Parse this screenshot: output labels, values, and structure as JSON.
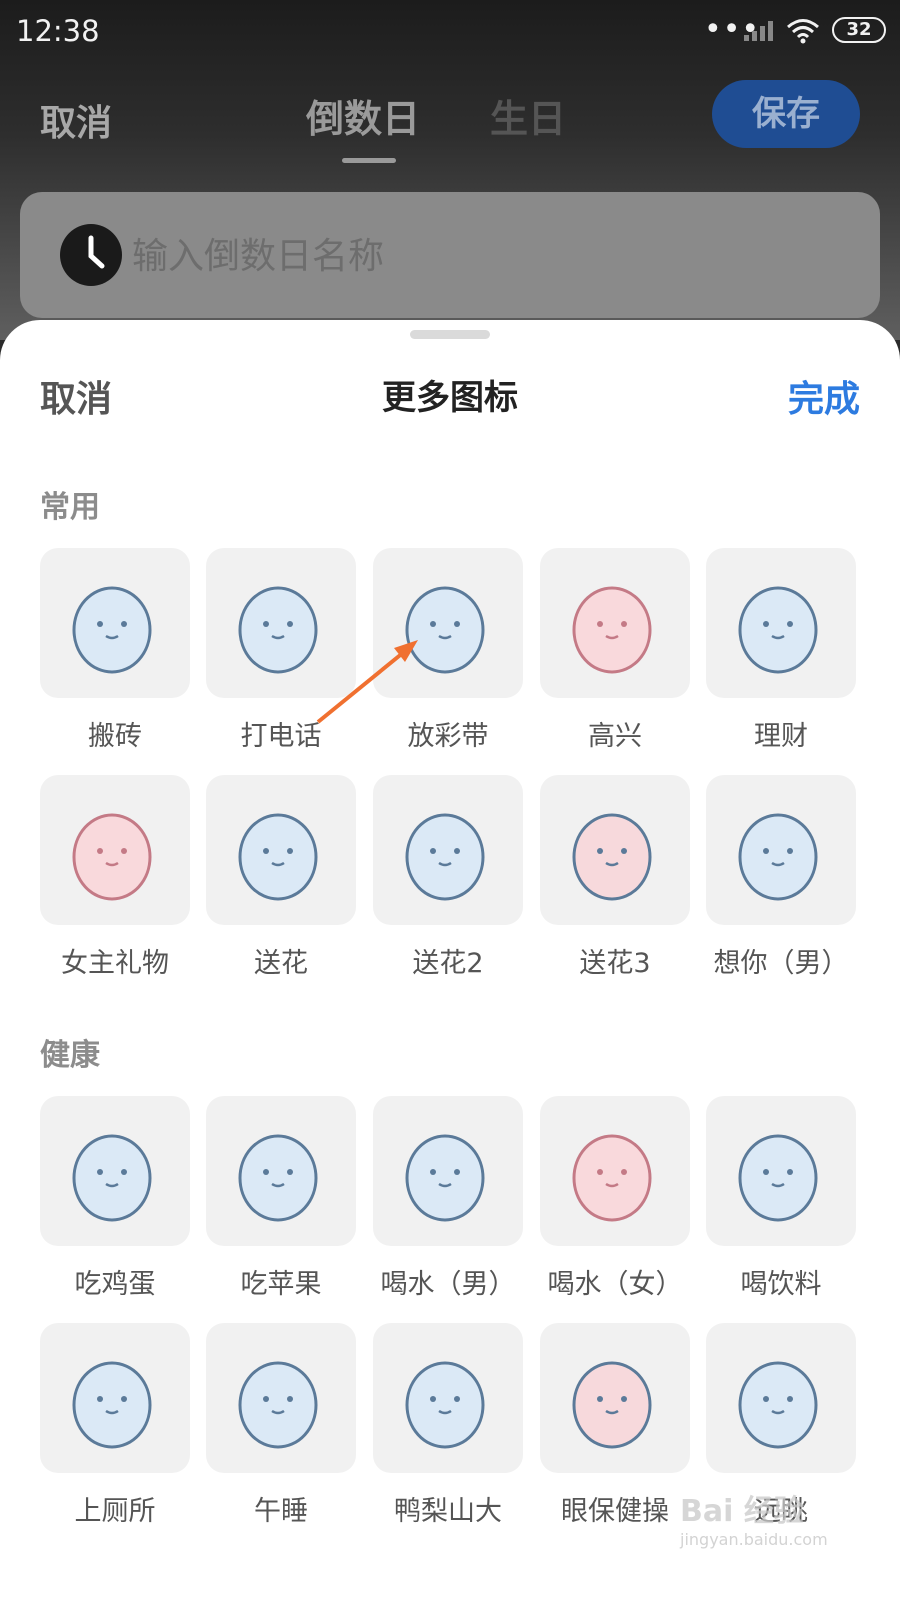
{
  "status_bar": {
    "time": "12:38",
    "battery": "32"
  },
  "top_bar": {
    "cancel": "取消",
    "tab_countdown": "倒数日",
    "tab_birthday": "生日",
    "save": "保存"
  },
  "name_input": {
    "placeholder": "输入倒数日名称",
    "value": ""
  },
  "sheet": {
    "cancel": "取消",
    "title": "更多图标",
    "done": "完成"
  },
  "sections": [
    {
      "title": "常用",
      "items": [
        "搬砖",
        "打电话",
        "放彩带",
        "高兴",
        "理财",
        "女主礼物",
        "送花",
        "送花2",
        "送花3",
        "想你（男）"
      ]
    },
    {
      "title": "健康",
      "items": [
        "吃鸡蛋",
        "吃苹果",
        "喝水（男）",
        "喝水（女）",
        "喝饮料",
        "上厕所",
        "午睡",
        "鸭梨山大",
        "眼保健操",
        "远眺"
      ]
    }
  ],
  "colors": {
    "accent": "#2d7be0",
    "save_button": "#1f4d93",
    "annotation_arrow": "#f07030"
  },
  "watermark": {
    "brand": "Bai 经验",
    "url": "jingyan.baidu.com"
  }
}
